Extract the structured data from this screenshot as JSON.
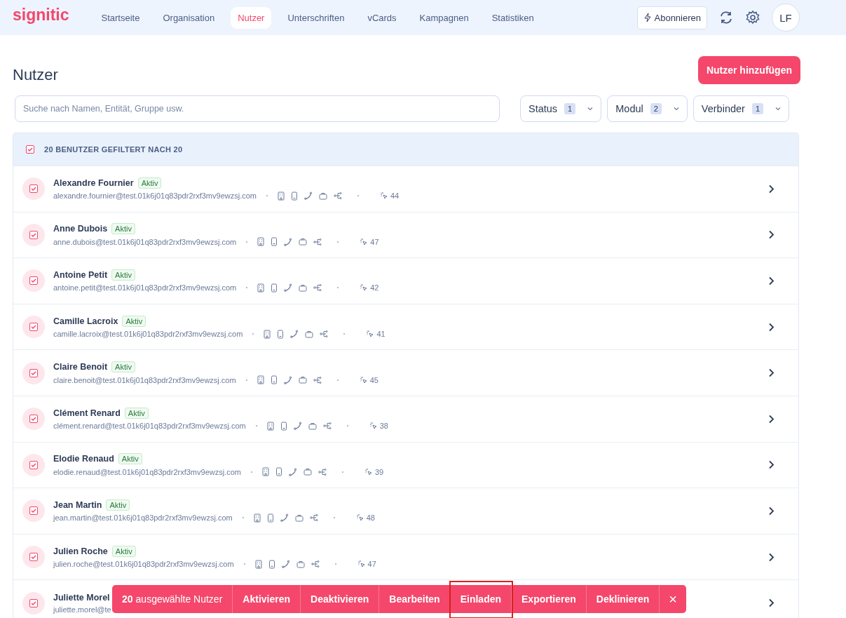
{
  "nav": {
    "logo": "signitic",
    "items": [
      {
        "label": "Startseite",
        "selected": false
      },
      {
        "label": "Organisation",
        "selected": false
      },
      {
        "label": "Nutzer",
        "selected": true
      },
      {
        "label": "Unterschriften",
        "selected": false
      },
      {
        "label": "vCards",
        "selected": false
      },
      {
        "label": "Kampagnen",
        "selected": false
      },
      {
        "label": "Statistiken",
        "selected": false
      }
    ],
    "subscribe": "Abonnieren",
    "avatar": "LF"
  },
  "page": {
    "title": "Nutzer",
    "add_button": "Nutzer hinzufügen"
  },
  "search": {
    "placeholder": "Suche nach Namen, Entität, Gruppe usw."
  },
  "filters": [
    {
      "label": "Status",
      "count": "1"
    },
    {
      "label": "Modul",
      "count": "2"
    },
    {
      "label": "Verbinder",
      "count": "1"
    }
  ],
  "list_header": {
    "checked": true,
    "label": "20 BENUTZER GEFILTERT NACH 20"
  },
  "users": [
    {
      "name": "Alexandre Fournier",
      "status": "Aktiv",
      "email": "alexandre.fournier@test.01k6j01q83pdr2rxf3mv9ewzsj.com",
      "checked": true,
      "clicks": "44"
    },
    {
      "name": "Anne Dubois",
      "status": "Aktiv",
      "email": "anne.dubois@test.01k6j01q83pdr2rxf3mv9ewzsj.com",
      "checked": true,
      "clicks": "47"
    },
    {
      "name": "Antoine Petit",
      "status": "Aktiv",
      "email": "antoine.petit@test.01k6j01q83pdr2rxf3mv9ewzsj.com",
      "checked": true,
      "clicks": "42"
    },
    {
      "name": "Camille Lacroix",
      "status": "Aktiv",
      "email": "camille.lacroix@test.01k6j01q83pdr2rxf3mv9ewzsj.com",
      "checked": true,
      "clicks": "41"
    },
    {
      "name": "Claire Benoit",
      "status": "Aktiv",
      "email": "claire.benoit@test.01k6j01q83pdr2rxf3mv9ewzsj.com",
      "checked": true,
      "clicks": "45"
    },
    {
      "name": "Clément Renard",
      "status": "Aktiv",
      "email": "clément.renard@test.01k6j01q83pdr2rxf3mv9ewzsj.com",
      "checked": true,
      "clicks": "38"
    },
    {
      "name": "Elodie Renaud",
      "status": "Aktiv",
      "email": "elodie.renaud@test.01k6j01q83pdr2rxf3mv9ewzsj.com",
      "checked": true,
      "clicks": "39"
    },
    {
      "name": "Jean Martin",
      "status": "Aktiv",
      "email": "jean.martin@test.01k6j01q83pdr2rxf3mv9ewzsj.com",
      "checked": true,
      "clicks": "48"
    },
    {
      "name": "Julien Roche",
      "status": "Aktiv",
      "email": "julien.roche@test.01k6j01q83pdr2rxf3mv9ewzsj.com",
      "checked": true,
      "clicks": "47"
    },
    {
      "name": "Juliette Morel",
      "email": "juliette.morel@te",
      "checked": true
    }
  ],
  "action_bar": {
    "count": "20",
    "count_label": "ausgewählte Nutzer",
    "actions": [
      {
        "label": "Aktivieren",
        "highlighted": false
      },
      {
        "label": "Deaktivieren",
        "highlighted": false
      },
      {
        "label": "Bearbeiten",
        "highlighted": false
      },
      {
        "label": "Einladen",
        "highlighted": true
      },
      {
        "label": "Exportieren",
        "highlighted": false
      },
      {
        "label": "Deklinieren",
        "highlighted": false
      }
    ],
    "close": "×"
  }
}
